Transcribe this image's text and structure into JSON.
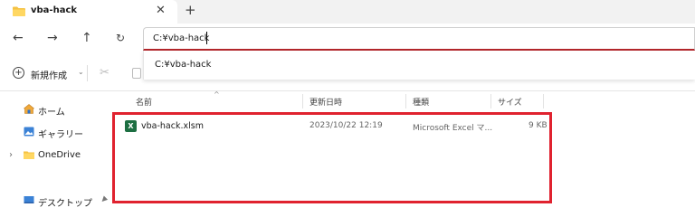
{
  "window": {
    "tab_title": "vba-hack",
    "close_glyph": "✕",
    "newtab_glyph": "+"
  },
  "nav": {
    "back": "←",
    "forward": "→",
    "up": "↑",
    "refresh": "↻"
  },
  "address": {
    "value": "C:¥vba-hack",
    "suggestion": "C:¥vba-hack"
  },
  "toolbar": {
    "new_label": "新規作成",
    "new_chevron": "⌄",
    "cut_glyph": "✂"
  },
  "sidebar": {
    "items": [
      {
        "label": "ホーム",
        "icon": "home-icon"
      },
      {
        "label": "ギャラリー",
        "icon": "gallery-icon"
      },
      {
        "label": "OneDrive",
        "icon": "folder-icon"
      },
      {
        "label": "デスクトップ",
        "icon": "desktop-icon"
      }
    ],
    "expander": "›",
    "pin_glyph": "📌"
  },
  "columns": {
    "name": "名前",
    "modified": "更新日時",
    "type": "種類",
    "size": "サイズ",
    "sort_glyph": "^"
  },
  "files": [
    {
      "name": "vba-hack.xlsm",
      "modified": "2023/10/22 12:19",
      "type": "Microsoft Excel マ...",
      "size": "9 KB",
      "icon_letter": "X"
    }
  ],
  "colors": {
    "highlight": "#e0222f",
    "address_underline": "#b3262b",
    "folder": "#f5c242",
    "excel": "#1d6f42"
  }
}
